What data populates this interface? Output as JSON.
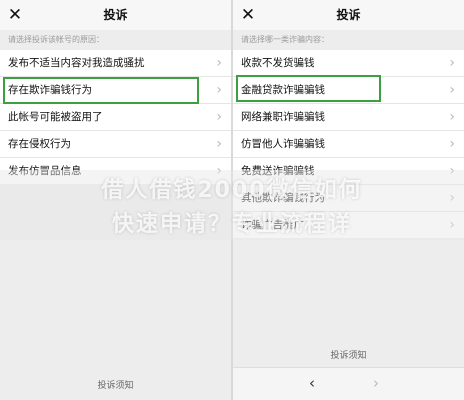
{
  "left_screen": {
    "title": "投诉",
    "close_glyph": "✕",
    "hint": "请选择投诉该帐号的原因：",
    "items": [
      {
        "label": "发布不适当内容对我造成骚扰"
      },
      {
        "label": "存在欺诈骗钱行为"
      },
      {
        "label": "此帐号可能被盗用了"
      },
      {
        "label": "存在侵权行为"
      },
      {
        "label": "发布仿冒品信息"
      }
    ],
    "selected_index": 1,
    "footer_link": "投诉须知"
  },
  "right_screen": {
    "title": "投诉",
    "close_glyph": "✕",
    "hint": "请选择哪一类诈骗内容：",
    "items": [
      {
        "label": "收款不发货骗钱"
      },
      {
        "label": "金融贷款诈骗骗钱"
      },
      {
        "label": "网络兼职诈骗骗钱"
      },
      {
        "label": "仿冒他人诈骗骗钱"
      },
      {
        "label": "免费送诈骗骗钱"
      },
      {
        "label": "其他欺诈骗钱行为"
      },
      {
        "label": "诈骗广告推广"
      }
    ],
    "selected_index": 1,
    "footer_link": "投诉须知",
    "nav": {
      "back": "‹",
      "forward": "›"
    }
  },
  "chevron": "›",
  "watermark": {
    "line1": "借人借钱2000微信如何",
    "line2": "快速申请？专业流程详"
  },
  "colors": {
    "selection": "#3aa040",
    "background": "#ededed",
    "list": "#ffffff"
  }
}
